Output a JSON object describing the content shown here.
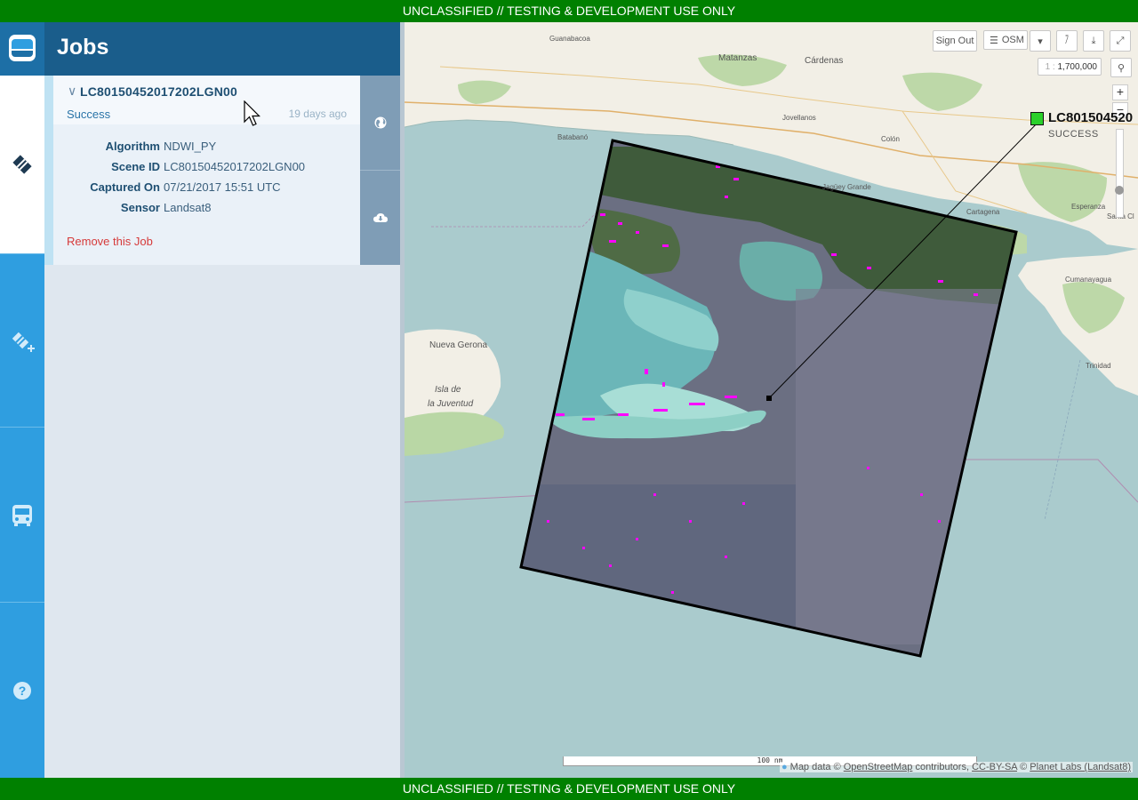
{
  "banner": {
    "text": "UNCLASSIFIED // TESTING & DEVELOPMENT USE ONLY"
  },
  "nav": {
    "items": [
      {
        "icon": "tracks-icon",
        "active": true
      },
      {
        "icon": "create-job-icon",
        "active": false
      },
      {
        "icon": "bus-icon",
        "active": false
      },
      {
        "icon": "help-icon",
        "active": false
      }
    ]
  },
  "panel": {
    "title": "Jobs",
    "job": {
      "name": "LC80150452017202LGN00",
      "status": "Success",
      "age": "19 days ago",
      "fields": {
        "algorithm_label": "Algorithm",
        "algorithm": "NDWI_PY",
        "scene_label": "Scene ID",
        "scene": "LC80150452017202LGN00",
        "captured_label": "Captured On",
        "captured": "07/21/2017 15:51 UTC",
        "sensor_label": "Sensor",
        "sensor": "Landsat8"
      },
      "remove": "Remove this Job",
      "actions": [
        "globe-icon",
        "download-icon"
      ]
    }
  },
  "map": {
    "toolbar": {
      "sign_out": "Sign Out",
      "basemap": "OSM"
    },
    "scale": {
      "prefix": "1 :",
      "value": "1,700,000"
    },
    "job_label": {
      "name": "LC801504520",
      "status": "SUCCESS"
    },
    "scalebar": "100 nm",
    "attribution": {
      "text1": "Map data ©",
      "osm": "OpenStreetMap",
      "text2": "contributors,",
      "license": "CC-BY-SA",
      "text3": "©",
      "planet": "Planet Labs (Landsat8)"
    },
    "places": {
      "nueva_gerona": "Nueva Gerona",
      "isla": "Isla de",
      "juventud": "la Juventud",
      "matanzas": "Matanzas",
      "cardenas": "Cárdenas",
      "havana": "Guanabacoa",
      "santa_clara": "Santa Cl",
      "colon": "Colón",
      "esperanza": "Esperanza",
      "trinidad": "Trinidad",
      "cienfuegos": "Cumanayagua",
      "jovellanos": "Jovellanos",
      "batabano": "Batabanó",
      "jaguey": "Jagüey Grande",
      "cartagena": "Cartagena"
    },
    "colors": {
      "sea": "#a9c9cc",
      "land": "#f1efe6",
      "green": "#b9d7a5",
      "detections": "#ff00ff"
    }
  }
}
